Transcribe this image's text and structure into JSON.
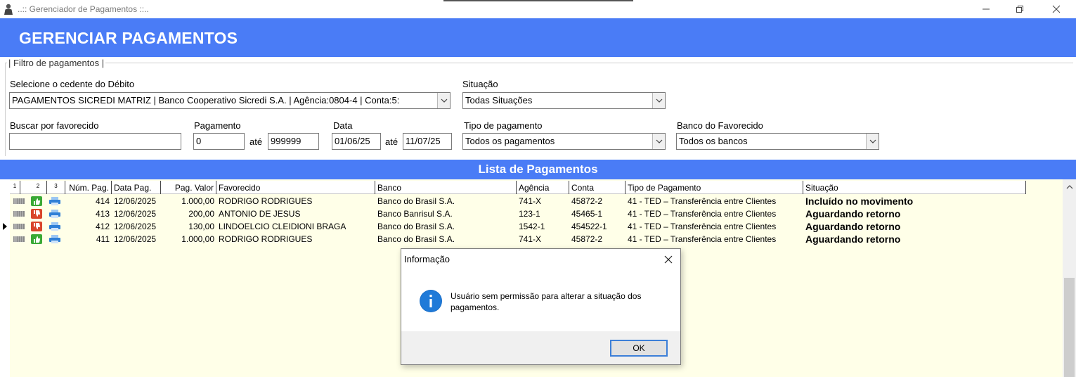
{
  "window": {
    "title": "..:: Gerenciador de Pagamentos ::.."
  },
  "header": {
    "title": "GERENCIAR PAGAMENTOS"
  },
  "filter": {
    "legend": "| Filtro de pagamentos |",
    "cedente_label": "Selecione o cedente do Débito",
    "cedente_value": "PAGAMENTOS SICREDI MATRIZ | Banco Cooperativo Sicredi S.A. | Agência:0804-4 | Conta:5:",
    "situacao_label": "Situação",
    "situacao_value": "Todas Situações",
    "favorecido_label": "Buscar por favorecido",
    "favorecido_value": "",
    "pagamento_label": "Pagamento",
    "pagamento_from": "0",
    "ate_label": "até",
    "pagamento_to": "999999",
    "data_label": "Data",
    "data_from": "01/06/25",
    "data_to": "11/07/25",
    "tipo_label": "Tipo de pagamento",
    "tipo_value": "Todos os pagamentos",
    "banco_label": "Banco do Favorecido",
    "banco_value": "Todos os bancos"
  },
  "list": {
    "title": "Lista de Pagamentos",
    "columns": [
      "1",
      "2",
      "3",
      "Núm. Pag.",
      "Data Pag.",
      "Pag. Valor",
      "Favorecido",
      "Banco",
      "Agência",
      "Conta",
      "Tipo de Pagamento",
      "Situação"
    ],
    "rows": [
      {
        "num": "414",
        "data": "12/06/2025",
        "valor": "1.000,00",
        "favorecido": "RODRIGO RODRIGUES",
        "banco": "Banco do Brasil S.A.",
        "agencia": "741-X",
        "conta": "45872-2",
        "tipo": "41 - TED – Transferência entre Clientes",
        "situacao": "Incluído no movimento",
        "status_icon": "thumbs-up-icon"
      },
      {
        "num": "413",
        "data": "12/06/2025",
        "valor": "200,00",
        "favorecido": "ANTONIO DE JESUS",
        "banco": "Banco Banrisul S.A.",
        "agencia": "123-1",
        "conta": "45465-1",
        "tipo": "41 - TED – Transferência entre Clientes",
        "situacao": "Aguardando retorno",
        "status_icon": "thumbs-down-icon"
      },
      {
        "num": "412",
        "data": "12/06/2025",
        "valor": "130,00",
        "favorecido": "LINDOELCIO CLEIDIONI BRAGA",
        "banco": "Banco do Brasil S.A.",
        "agencia": "1542-1",
        "conta": "454522-1",
        "tipo": "41 - TED – Transferência entre Clientes",
        "situacao": "Aguardando retorno",
        "status_icon": "thumbs-down-icon"
      },
      {
        "num": "411",
        "data": "12/06/2025",
        "valor": "1.000,00",
        "favorecido": "RODRIGO RODRIGUES",
        "banco": "Banco do Brasil S.A.",
        "agencia": "741-X",
        "conta": "45872-2",
        "tipo": "41 - TED – Transferência entre Clientes",
        "situacao": "Aguardando retorno",
        "status_icon": "thumbs-up-icon"
      }
    ]
  },
  "dialog": {
    "title": "Informação",
    "message": "Usuário sem permissão para alterar a situação dos pagamentos.",
    "ok_label": "OK",
    "icon": "info-icon"
  },
  "colors": {
    "accent": "#4a7cf6",
    "grid_bg": "#ffffe8",
    "thumbs_up": "#3aa935",
    "thumbs_down": "#d9452b",
    "printer": "#2f7fd6"
  }
}
